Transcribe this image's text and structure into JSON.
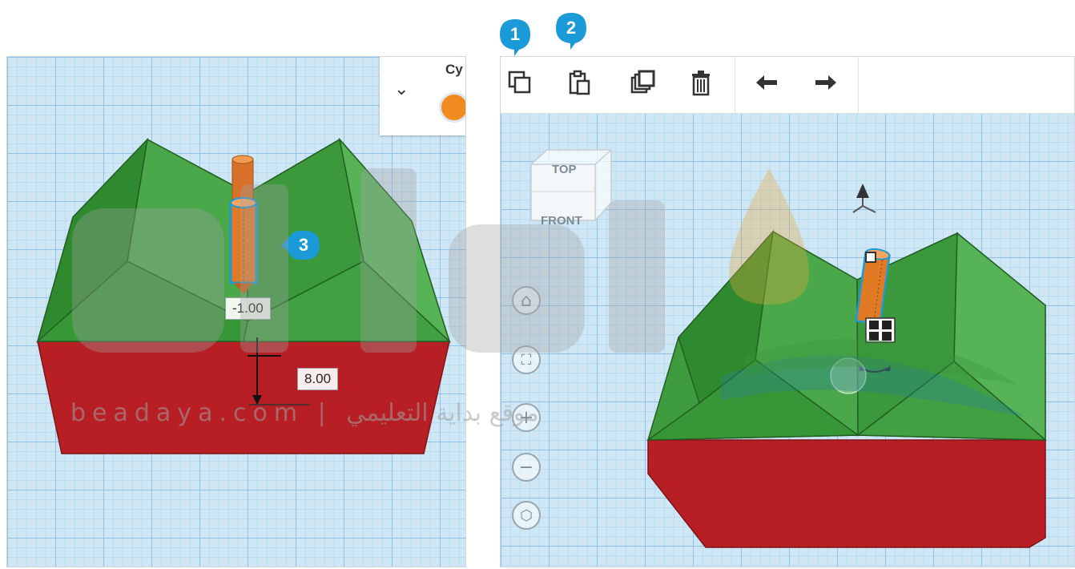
{
  "left_panel": {
    "inspector": {
      "shape_title": "Cy",
      "chevron": "chevron-down-icon",
      "color_swatch": "#f08b1f"
    },
    "labels": {
      "offset_value": "-1.00",
      "height_value": "8.00"
    },
    "callout": "3"
  },
  "right_panel": {
    "toolbar": {
      "tools": [
        {
          "name": "copy",
          "icon": "copy-icon"
        },
        {
          "name": "paste",
          "icon": "paste-icon"
        },
        {
          "name": "duplicate",
          "icon": "duplicate-icon"
        },
        {
          "name": "delete",
          "icon": "trash-icon"
        },
        {
          "name": "undo",
          "icon": "undo-icon"
        },
        {
          "name": "redo",
          "icon": "redo-icon"
        }
      ]
    },
    "viewcube": {
      "top_label": "TOP",
      "front_label": "FRONT"
    },
    "nav": [
      "home-icon",
      "fit-view-icon",
      "zoom-in-icon",
      "zoom-out-icon",
      "perspective-icon"
    ],
    "callouts": [
      "1",
      "2"
    ]
  },
  "watermark": {
    "text": "beadaya.com | موقع بداية التعليمي"
  },
  "colors": {
    "green": "#3e9b3e",
    "red": "#b71f24",
    "orange": "#e07a25",
    "accent": "#1a9ad6"
  }
}
